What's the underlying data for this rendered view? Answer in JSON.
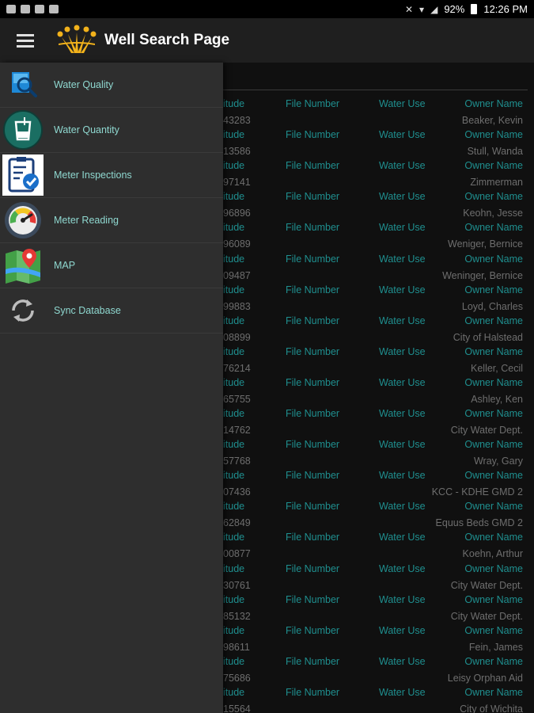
{
  "status_bar": {
    "battery": "92%",
    "time": "12:26 PM"
  },
  "app_bar": {
    "title": "Well Search Page"
  },
  "drawer": {
    "items": [
      {
        "label": "Water Quality",
        "icon": "water-quality-magnifier-icon"
      },
      {
        "label": "Water Quantity",
        "icon": "water-quantity-beaker-icon"
      },
      {
        "label": "Meter Inspections",
        "icon": "clipboard-check-icon"
      },
      {
        "label": "Meter Reading",
        "icon": "gauge-icon"
      },
      {
        "label": "MAP",
        "icon": "map-pin-icon"
      },
      {
        "label": "Sync Database",
        "icon": "sync-icon"
      }
    ]
  },
  "results": {
    "headers": {
      "latitude": "itude",
      "file_number": "File Number",
      "water_use": "Water Use",
      "owner_name": "Owner Name"
    },
    "rows": [
      {
        "lat": "43283",
        "owner": "Beaker, Kevin"
      },
      {
        "lat": "13586",
        "owner": "Stull, Wanda"
      },
      {
        "lat": "97141",
        "owner": "Zimmerman"
      },
      {
        "lat": "96896",
        "owner": "Keohn, Jesse"
      },
      {
        "lat": "96089",
        "owner": "Weniger, Bernice"
      },
      {
        "lat": "09487",
        "owner": "Weninger, Bernice"
      },
      {
        "lat": "99883",
        "owner": "Loyd, Charles"
      },
      {
        "lat": "08899",
        "owner": "City of Halstead"
      },
      {
        "lat": "76214",
        "owner": "Keller, Cecil"
      },
      {
        "lat": "65755",
        "owner": "Ashley, Ken"
      },
      {
        "lat": "14762",
        "owner": "City Water Dept."
      },
      {
        "lat": "57768",
        "owner": "Wray, Gary"
      },
      {
        "lat": "07436",
        "owner": "KCC - KDHE GMD 2"
      },
      {
        "lat": "62849",
        "owner": "Equus Beds GMD 2"
      },
      {
        "lat": "00877",
        "owner": "Koehn, Arthur"
      },
      {
        "lat": "30761",
        "owner": "City Water Dept."
      },
      {
        "lat": "85132",
        "owner": "City Water Dept."
      },
      {
        "lat": "98611",
        "owner": "Fein, James"
      },
      {
        "lat": "75686",
        "owner": "Leisy Orphan Aid"
      },
      {
        "lat": "15564",
        "owner": "City of Wichita"
      }
    ]
  }
}
